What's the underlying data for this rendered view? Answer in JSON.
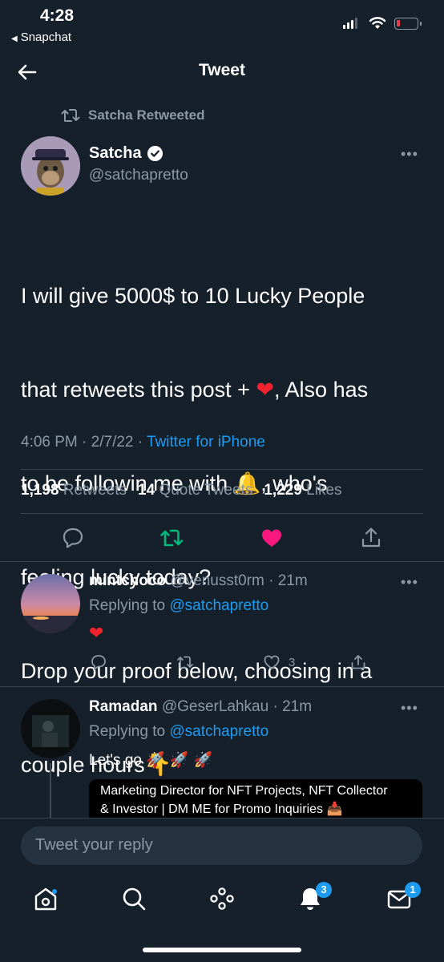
{
  "status_bar": {
    "time": "4:28",
    "back_app": "Snapchat",
    "back_triangle": "◀"
  },
  "header": {
    "title": "Tweet"
  },
  "retweet": {
    "label": "Satcha Retweeted"
  },
  "tweet": {
    "author_name": "Satcha",
    "author_handle": "@satchapretto",
    "more": "•••",
    "text_line1": "I will give 5000$ to 10 Lucky People",
    "text_line2a": "that retweets this post + ",
    "text_line2b": ", Also has",
    "text_line3a": "to be followin me with ",
    "text_line3b": ", who's",
    "text_line4": "feeling lucky today?",
    "text_line5": "Drop your proof below, choosing in a",
    "text_line6": "couple hours",
    "emoji_heart": "❤",
    "emoji_bell": "🔔",
    "emoji_point": "👇",
    "time": "4:06 PM",
    "date": "2/7/22",
    "separator": "·",
    "source": "Twitter for iPhone"
  },
  "stats": {
    "retweets_count": "1,198",
    "retweets_label": "Retweets",
    "quotes_count": "14",
    "quotes_label": "Quote Tweets",
    "likes_count": "1,229",
    "likes_label": "Likes"
  },
  "replies": [
    {
      "name": "mintchoco",
      "handle": "@venusst0rm",
      "time": "21m",
      "replying_label": "Replying to",
      "replying_to": "@satchapretto",
      "body": "❤",
      "like_count": "3",
      "more": "•••"
    },
    {
      "name": "Ramadan",
      "handle": "@GeserLahkau",
      "time": "21m",
      "replying_label": "Replying to",
      "replying_to": "@satchapretto",
      "body_text": "Let's go",
      "body_emoji": "🚀 🚀 🚀",
      "bio_line1": "Marketing Director for NFT Projects, NFT Collector",
      "bio_line2": "& Investor | DM ME for Promo Inquiries",
      "bio_emoji": "📥",
      "more": "•••"
    }
  ],
  "composer": {
    "placeholder": "Tweet your reply"
  },
  "nav": {
    "notifications_badge": "3",
    "messages_badge": "1"
  },
  "colors": {
    "background": "#15202b",
    "accent": "#1d9bf0",
    "retweet_green": "#00ba7c",
    "like_pink": "#f91880",
    "muted": "#8b98a5"
  }
}
